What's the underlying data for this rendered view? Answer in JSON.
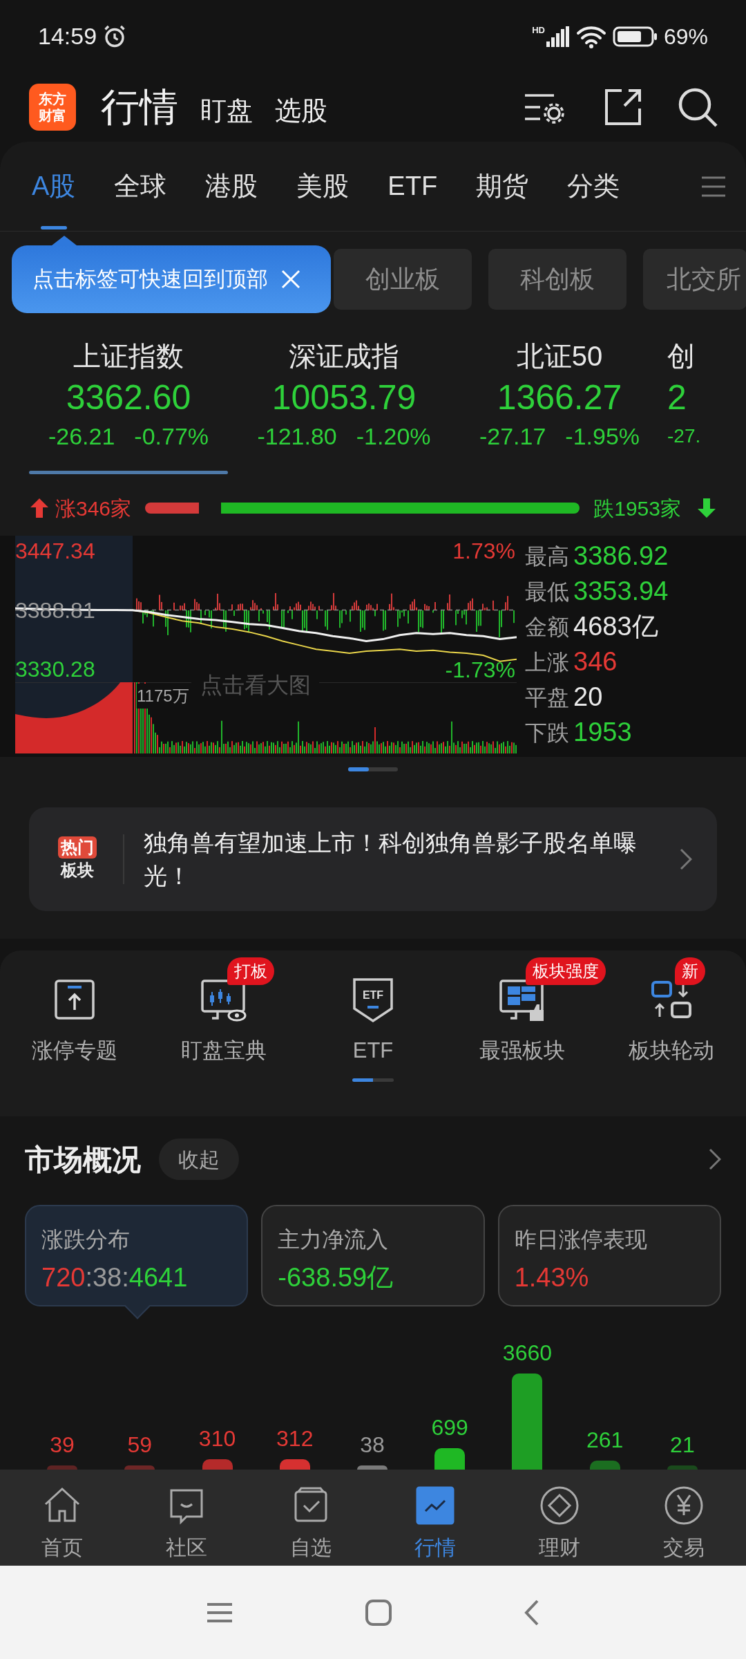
{
  "status_bar": {
    "time": "14:59",
    "network": "HD",
    "battery": "69%"
  },
  "header": {
    "logo": [
      "东方",
      "财富"
    ],
    "title": "行情",
    "links": [
      {
        "label": "盯盘"
      },
      {
        "label": "选股"
      }
    ]
  },
  "market_tabs": [
    {
      "label": "A股",
      "selected": true
    },
    {
      "label": "全球",
      "selected": false
    },
    {
      "label": "港股",
      "selected": false
    },
    {
      "label": "美股",
      "selected": false
    },
    {
      "label": "ETF",
      "selected": false
    },
    {
      "label": "期货",
      "selected": false
    },
    {
      "label": "分类",
      "selected": false
    }
  ],
  "tooltip": {
    "text": "点击标签可快速回到顶部"
  },
  "board_chips": [
    {
      "label": "创业板"
    },
    {
      "label": "科创板"
    },
    {
      "label": "北交所"
    }
  ],
  "indices": [
    {
      "name": "上证指数",
      "value": "3362.60",
      "change": "-26.21",
      "percent": "-0.77%",
      "color": "#2ed13a",
      "selected": true
    },
    {
      "name": "深证成指",
      "value": "10053.79",
      "change": "-121.80",
      "percent": "-1.20%",
      "color": "#2ed13a",
      "selected": false
    },
    {
      "name": "北证50",
      "value": "1366.27",
      "change": "-27.17",
      "percent": "-1.95%",
      "color": "#2ed13a",
      "selected": false
    },
    {
      "name": "创",
      "value": "2",
      "change": "-27.",
      "color": "#2ed13a",
      "selected": false
    }
  ],
  "breadth": {
    "up_label": "涨346家",
    "down_label": "跌1953家",
    "level": 0.15
  },
  "intraday": {
    "pct_high": "1.73%",
    "pct_low": "-1.73%",
    "volume": "1175万",
    "hint": "点击看大图",
    "chart_data": {
      "type": "line",
      "ylim": [
        3317.3,
        3462.4
      ],
      "yticks": [
        {
          "value": 3447.34,
          "label": "3447.34"
        },
        {
          "value": 3388.81,
          "label": "3388.81"
        },
        {
          "value": 3330.28,
          "label": "3330.28"
        }
      ],
      "series": [
        {
          "color": "#f0f0f0",
          "values": [
            3390.5,
            3390,
            3389.6,
            3389.3,
            3389,
            3388.9,
            3388.8,
            3388.6,
            3387,
            3384,
            3382,
            3380,
            3379,
            3377,
            3375,
            3374,
            3371,
            3368,
            3366,
            3363,
            3361,
            3358,
            3360,
            3364,
            3366,
            3365,
            3366,
            3364,
            3363,
            3360,
            3362
          ]
        },
        {
          "color": "#e8d44a",
          "values": [
            null,
            null,
            null,
            null,
            null,
            null,
            null,
            3388.8,
            3386,
            3382,
            3378,
            3376,
            3372,
            3370,
            3367,
            3363,
            3358,
            3354,
            3350,
            3348,
            3346,
            3348,
            3349,
            3350,
            3348,
            3349,
            3347,
            3346,
            3344,
            3338,
            3340
          ]
        }
      ]
    }
  },
  "stats": [
    {
      "label": "最高",
      "value": "3386.92",
      "color": "#2ed13a"
    },
    {
      "label": "最低",
      "value": "3353.94",
      "color": "#2ed13a"
    },
    {
      "label": "金额",
      "value": "4683亿",
      "color": "#e8e8e8"
    },
    {
      "label": "上涨",
      "value": "346",
      "color": "#e53935"
    },
    {
      "label": "平盘",
      "value": "20",
      "color": "#e8e8e8"
    },
    {
      "label": "下跌",
      "value": "1953",
      "color": "#2ed13a"
    }
  ],
  "hot_topic": {
    "tag": "热门",
    "label": "板块",
    "text": "独角兽有望加速上市！科创独角兽影子股名单曝光！"
  },
  "shortcuts": [
    {
      "label": "涨停专题",
      "kind": "limit-up"
    },
    {
      "label": "盯盘宝典",
      "kind": "monitor",
      "badge": "打板"
    },
    {
      "label": "ETF",
      "kind": "etf",
      "icon_text": "ETF",
      "selected": true
    },
    {
      "label": "最强板块",
      "kind": "strongest",
      "badge": "板块强度"
    },
    {
      "label": "板块轮动",
      "kind": "rotation",
      "badge": "新"
    }
  ],
  "overview": {
    "title": "市场概况",
    "toggle": "收起",
    "cards": [
      {
        "title": "涨跌分布",
        "selected": true,
        "parts": [
          {
            "text": "720",
            "color": "#e53935"
          },
          {
            "text": ":38:",
            "color": "#9a9a9a"
          },
          {
            "text": "4641",
            "color": "#2ed13a"
          }
        ]
      },
      {
        "title": "主力净流入",
        "selected": false,
        "parts": [
          {
            "text": "-638.59亿",
            "color": "#2ed13a"
          }
        ]
      },
      {
        "title": "昨日涨停表现",
        "selected": false,
        "parts": [
          {
            "text": "1.43%",
            "color": "#e53935"
          }
        ]
      }
    ],
    "distribution": [
      {
        "label": {
          "text": "39",
          "color": "#e53935"
        },
        "bar": {
          "color": "#5e2323"
        }
      },
      {
        "label": {
          "text": "59",
          "color": "#e53935"
        },
        "bar": {
          "color": "#6e2626"
        }
      },
      {
        "label": {
          "text": "310",
          "color": "#e53935"
        },
        "bar": {
          "color": "#b52a2a"
        }
      },
      {
        "label": {
          "text": "312",
          "color": "#e53935"
        },
        "bar": {
          "color": "#d63030"
        }
      },
      {
        "label": {
          "text": "38",
          "color": "#9a9a9a"
        },
        "bar": {
          "color": "#7a7a7a"
        }
      },
      {
        "label": {
          "text": "699",
          "color": "#2ed13a"
        },
        "bar": {
          "color": "#1fb824"
        }
      },
      {
        "label": {
          "text": "3660",
          "color": "#2ed13a"
        },
        "bar": {
          "color": "#1e9e24"
        }
      },
      {
        "label": {
          "text": "261",
          "color": "#2ed13a"
        },
        "bar": {
          "color": "#1b6e20"
        }
      },
      {
        "label": {
          "text": "21",
          "color": "#2ed13a"
        },
        "bar": {
          "color": "#1a4a1c"
        }
      }
    ]
  },
  "bottom_nav": [
    {
      "label": "首页",
      "kind": "home",
      "selected": false
    },
    {
      "label": "社区",
      "kind": "community",
      "selected": false
    },
    {
      "label": "自选",
      "kind": "watchlist",
      "selected": false
    },
    {
      "label": "行情",
      "kind": "market",
      "selected": true
    },
    {
      "label": "理财",
      "kind": "wealth",
      "selected": false
    },
    {
      "label": "交易",
      "kind": "trade",
      "selected": false
    }
  ]
}
